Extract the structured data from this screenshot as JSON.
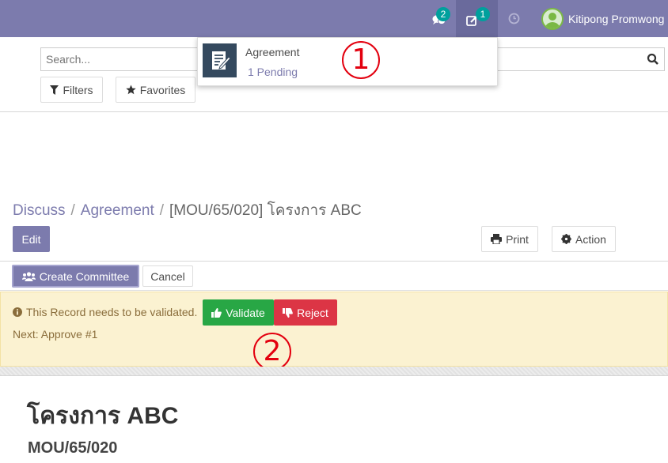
{
  "navbar": {
    "messages_count": "2",
    "activities_count": "1",
    "user_name": "Kitipong Promwong",
    "background": "#7c7bad"
  },
  "search": {
    "placeholder": "Search..."
  },
  "filters_label": "Filters",
  "favorites_label": "Favorites",
  "activity_dropdown": {
    "title": "Agreement",
    "pending": "1 Pending"
  },
  "annotations": {
    "first": "1",
    "second": "2"
  },
  "breadcrumb": {
    "root": "Discuss",
    "model": "Agreement",
    "separator": "/",
    "record": "[MOU/65/020] โครงการ ABC"
  },
  "buttons": {
    "edit": "Edit",
    "print": "Print",
    "action": "Action",
    "create_committee": "Create Committee",
    "cancel": "Cancel",
    "validate": "Validate",
    "reject": "Reject"
  },
  "alert": {
    "message": "This Record needs to be validated.",
    "next": "Next: Approve #1"
  },
  "record": {
    "name": "โครงการ ABC",
    "code": "MOU/65/020"
  },
  "colors": {
    "primary": "#7c7bad",
    "success": "#28a745",
    "danger": "#dc3545",
    "alert_bg": "#fbf2d1",
    "annotation": "#e3000f"
  }
}
